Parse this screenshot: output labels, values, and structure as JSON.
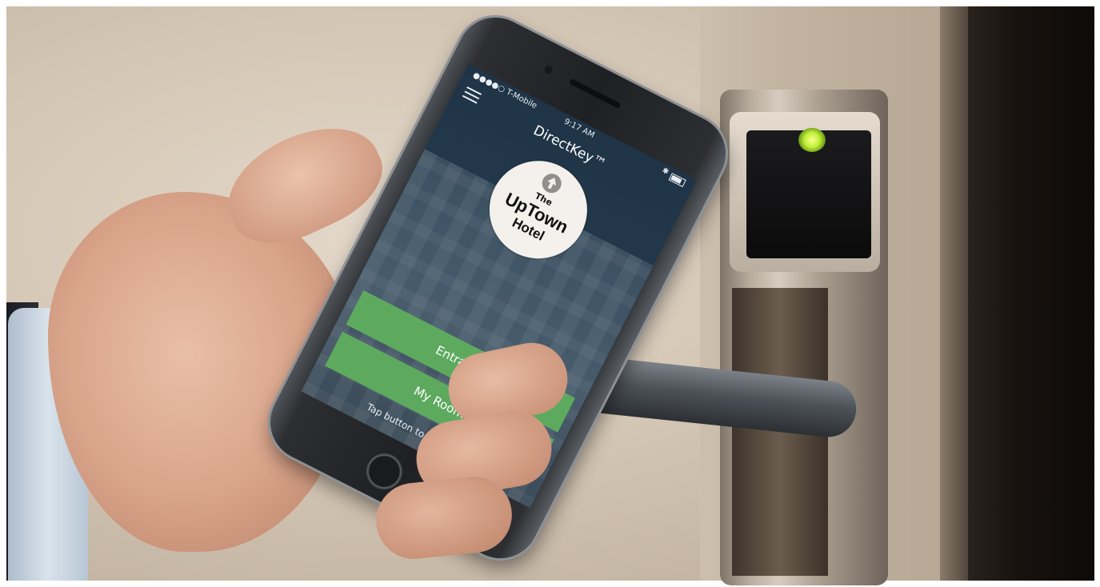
{
  "phone": {
    "status_bar": {
      "carrier": "●●●●○ T-Mobile",
      "time": "9:17 AM",
      "bluetooth_icon": "bluetooth-icon",
      "battery_icon": "battery-icon"
    },
    "header": {
      "menu_icon": "hamburger-menu-icon",
      "title": "DirectKey™"
    },
    "logo": {
      "icon": "up-arrow-icon",
      "line1": "The",
      "line2": "UpTown",
      "line3": "Hotel"
    },
    "buttons": {
      "entrance": "Entrance",
      "my_room": "My Room"
    },
    "hint": "Tap button to unlock door.",
    "colors": {
      "button": "#5daa5f",
      "screen_bg": "#243b4d",
      "logo_bg": "#f4f1ec"
    }
  },
  "scene": {
    "lock_led_color": "#c4f03a"
  }
}
